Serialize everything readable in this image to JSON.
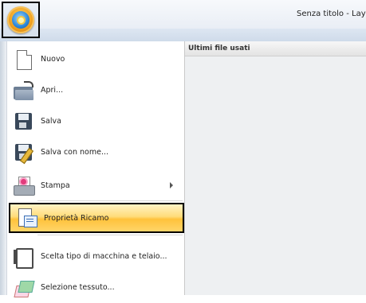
{
  "window": {
    "title": "Senza titolo - Layou"
  },
  "app_button": {
    "icon": "app-orb-icon"
  },
  "recent": {
    "header": "Ultimi file usati"
  },
  "menu": {
    "items": [
      {
        "label": "Nuovo",
        "icon": "new-document-icon"
      },
      {
        "label": "Apri...",
        "icon": "open-folder-icon"
      },
      {
        "label": "Salva",
        "icon": "save-disk-icon"
      },
      {
        "label": "Salva con nome...",
        "icon": "save-as-icon"
      },
      {
        "label": "Stampa",
        "icon": "print-icon",
        "has_submenu": true
      },
      {
        "label": "Proprietà Ricamo",
        "icon": "embroidery-properties-icon",
        "highlighted": true
      },
      {
        "label": "Scelta tipo di macchina e telaio...",
        "icon": "machine-hoop-icon"
      },
      {
        "label": "Selezione tessuto...",
        "icon": "fabric-icon"
      }
    ]
  },
  "colors": {
    "highlight": "#ffd56a",
    "accent_orb": "#f0a020"
  }
}
